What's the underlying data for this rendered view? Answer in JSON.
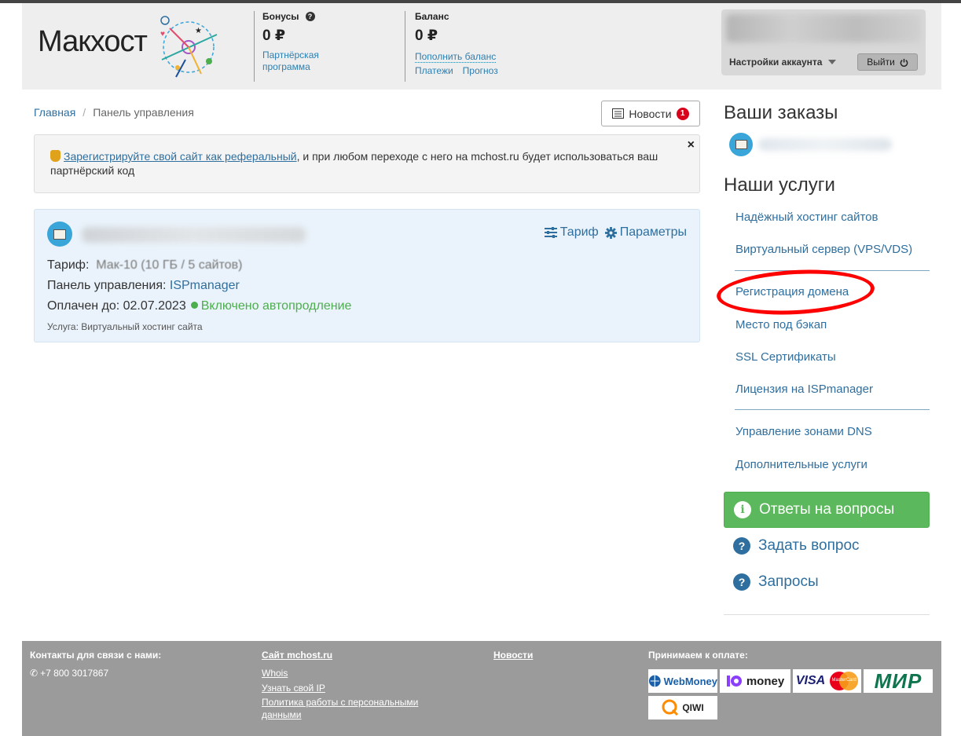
{
  "header": {
    "logo_text": "Макхост",
    "bonus": {
      "label": "Бонусы",
      "amount": "0 ₽",
      "link_line1": "Партнёрская",
      "link_line2": "программа"
    },
    "balance": {
      "label": "Баланс",
      "amount": "0 ₽",
      "topup": "Пополнить баланс",
      "payments": "Платежи",
      "forecast": "Прогноз"
    },
    "account": {
      "settings": "Настройки аккаунта",
      "logout": "Выйти"
    }
  },
  "breadcrumb": {
    "home": "Главная",
    "separator": "/",
    "current": "Панель управления"
  },
  "news_button": {
    "label": "Новости",
    "badge": "1"
  },
  "alert": {
    "link": "Зарегистрируйте свой сайт как реферальный",
    "text": ", и при любом переходе с него на mchost.ru будет использоваться ваш партнёрский код",
    "close": "×"
  },
  "service": {
    "tariff_action": "Тариф",
    "params_action": "Параметры",
    "tariff_label": "Тариф:",
    "tariff_value": "Мак-10 (10 ГБ / 5 сайтов)",
    "panel_label": "Панель управления:",
    "panel_value": "ISPmanager",
    "paid_label": "Оплачен до: 02.07.2023",
    "autorenew": "Включено автопродление",
    "service_type": "Услуга: Виртуальный хостинг сайта"
  },
  "sidebar": {
    "orders_title": "Ваши заказы",
    "services_title": "Наши услуги",
    "services": [
      "Надёжный хостинг сайтов",
      "Виртуальный сервер (VPS/VDS)",
      "Регистрация домена",
      "Место под бэкап",
      "SSL Сертификаты",
      "Лицензия на ISPmanager",
      "Управление зонами DNS",
      "Дополнительные услуги"
    ],
    "faq": "Ответы на вопросы",
    "ask": "Задать вопрос",
    "requests": "Запросы"
  },
  "footer": {
    "contacts_title": "Контакты для связи с нами:",
    "phone": "+7 800 3017867",
    "site_title": "Сайт mchost.ru",
    "whois": "Whois",
    "my_ip": "Узнать свой IP",
    "privacy_line1": "Политика работы с персональными",
    "privacy_line2": "данными",
    "news": "Новости",
    "payment_title": "Принимаем к оплате:",
    "payments": {
      "webmoney": "WebMoney",
      "yoomoney": "money",
      "visa": "VISA",
      "mastercard": "MasterCard",
      "mir": "МИР",
      "qiwi": "QIWI"
    }
  },
  "colors": {
    "accent": "#2f6f9f",
    "success": "#5cb85c",
    "highlight": "#ff0000",
    "footer": "#9b9b9b"
  }
}
